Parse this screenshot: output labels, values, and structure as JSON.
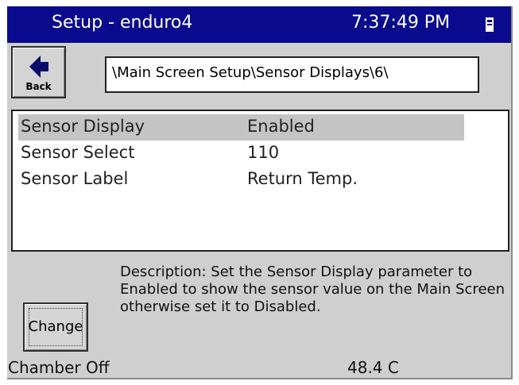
{
  "titlebar": {
    "title": "Setup - enduro4",
    "clock": "7:37:49 PM",
    "tray_icon": "signal-indicator-icon"
  },
  "back_button": {
    "label": "Back",
    "icon": "left-arrow-icon"
  },
  "path": {
    "value": "\\Main Screen Setup\\Sensor Displays\\6\\"
  },
  "parameters": [
    {
      "name": "Sensor Display",
      "value": "Enabled",
      "selected": true
    },
    {
      "name": "Sensor Select",
      "value": "110",
      "selected": false
    },
    {
      "name": "Sensor Label",
      "value": "Return Temp.",
      "selected": false
    }
  ],
  "description": {
    "text": "Description:  Set the Sensor Display parameter to Enabled to show the sensor value on the Main Screen otherwise set it to Disabled."
  },
  "change_button": {
    "label": "Change"
  },
  "status": {
    "chamber": "Chamber Off",
    "temperature": "48.4 C"
  },
  "colors": {
    "titlebar_bg": "#0a0a8c",
    "panel_bg": "#cfcfcf",
    "selection_bg": "#c4c4c4"
  }
}
